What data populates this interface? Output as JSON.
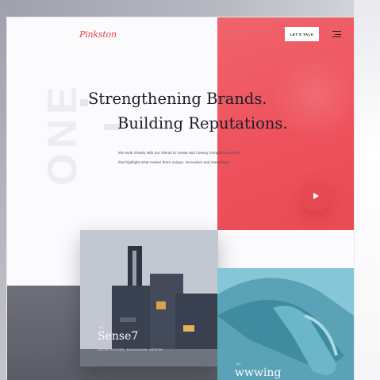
{
  "brand": {
    "logo_text": "Pinkston"
  },
  "header": {
    "cta_label": "LET'S TALK",
    "menu_icon": "hamburger-icon"
  },
  "hero": {
    "headline_line1": "Strengthening Brands.",
    "headline_line2": "Building Reputations.",
    "intro_line1": "We work closely with our clients to create and convey compelling stories",
    "intro_line2": "that highlight what makes them unique, innovative and interesting.",
    "play_icon": "play-icon",
    "background_word": "ONE"
  },
  "projects": [
    {
      "number": "01",
      "title": "Sense7",
      "tags": "ARCHITECTURE, EDUCATION, DESIGN"
    },
    {
      "number": "02",
      "title": "wwwing"
    }
  ],
  "colors": {
    "accent_red": "#ee525c",
    "dark_text": "#1d1d29",
    "bottom_band": "#5b5c66"
  }
}
